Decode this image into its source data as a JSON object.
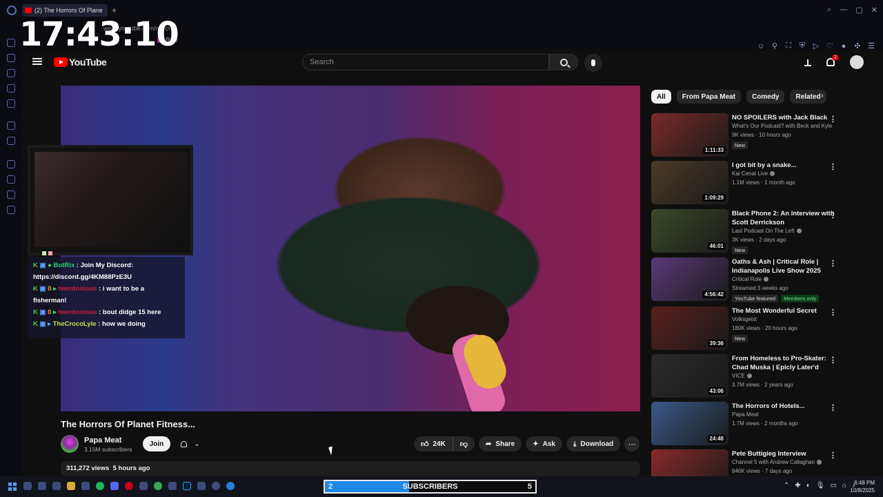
{
  "browser": {
    "tab_title": "(2) The Horrors Of Plane",
    "url": "www.youtube.com/watch",
    "bookmark_label": "Rive"
  },
  "stream_overlay": {
    "clock": "17:43:10",
    "chat": [
      {
        "user": "BotRix",
        "message": "Join My Discord: https://discord.gg/4KM88PzE3U"
      },
      {
        "user": "twentonious",
        "message": "i want to be a fisherman!"
      },
      {
        "user": "twentonious",
        "message": "bout didge 15 here"
      },
      {
        "user": "TheCrocoLyle",
        "message": "how we doing"
      }
    ]
  },
  "header": {
    "logo_text": "YouTube",
    "search_placeholder": "Search",
    "notification_count": "2"
  },
  "video": {
    "title": "The Horrors Of Planet Fitness...",
    "channel_name": "Papa Meat",
    "subscribers": "3.15M subscribers",
    "join_label": "Join",
    "likes": "24K",
    "share_label": "Share",
    "ask_label": "Ask",
    "download_label": "Download",
    "views_line": "311,272 views  5 hours ago"
  },
  "chips": [
    "All",
    "From Papa Meat",
    "Comedy",
    "Related"
  ],
  "recommendations": [
    {
      "title": "NO SPOILERS with Jack Black",
      "channel": "What's Our Podcast? with Beck and Kyle",
      "meta": "9K views · 10 hours ago",
      "duration": "1:11:33",
      "badges": [
        "New"
      ],
      "thumb": "#7a2a2a"
    },
    {
      "title": "I got bit by a snake...",
      "channel": "Kai Cenat Live",
      "meta": "1.1M views · 1 month ago",
      "duration": "1:09:29",
      "badges": [],
      "thumb": "#4a3a28"
    },
    {
      "title": "Black Phone 2: An Interview with Scott Derrickson",
      "channel": "Last Podcast On The Left",
      "meta": "3K views · 2 days ago",
      "duration": "46:01",
      "badges": [
        "New"
      ],
      "thumb": "#3a4a2a"
    },
    {
      "title": "Oaths & Ash | Critical Role | Indianapolis Live Show 2025",
      "channel": "Critical Role",
      "meta": "Streamed 3 weeks ago",
      "duration": "4:56:42",
      "badges": [
        "YouTube featured",
        "Members only"
      ],
      "thumb": "#5a3a7a"
    },
    {
      "title": "The Most Wonderful Secret",
      "channel": "Volksgeist",
      "meta": "180K views · 20 hours ago",
      "duration": "39:36",
      "badges": [
        "New"
      ],
      "thumb": "#5a1e1e"
    },
    {
      "title": "From Homeless to Pro-Skater: Chad Muska | Epicly Later'd",
      "channel": "VICE",
      "meta": "3.7M views · 2 years ago",
      "duration": "43:06",
      "badges": [],
      "thumb": "#2a2a2a"
    },
    {
      "title": "The Horrors of Hotels...",
      "channel": "Papa Meat",
      "meta": "1.7M views · 2 months ago",
      "duration": "24:48",
      "badges": [],
      "thumb": "#3a5a8a"
    },
    {
      "title": "Pete Buttigieg Interview",
      "channel": "Channel 5 with Andrew Callaghan",
      "meta": "846K views · 7 days ago",
      "duration": "",
      "badges": [],
      "thumb": "#8a2a2a"
    }
  ],
  "subscriber_goal": {
    "start": "2",
    "label": "SUBSCRIBERS",
    "goal": "5",
    "progress_fraction": 0.4
  },
  "taskbar": {
    "time": "6:48 PM",
    "date": "10/8/2025"
  }
}
